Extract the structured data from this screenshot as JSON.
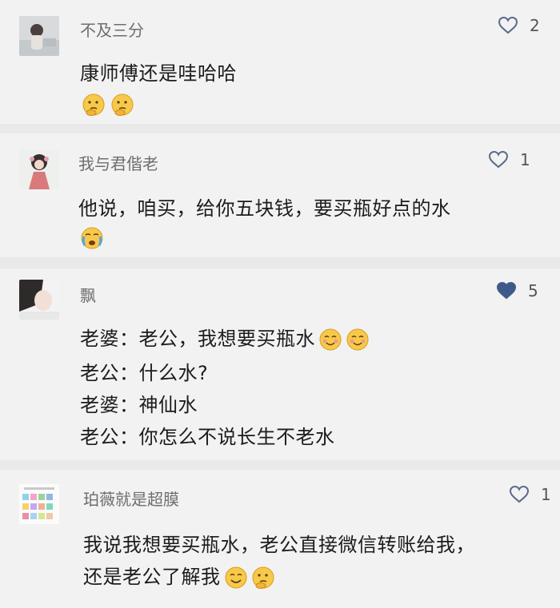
{
  "comments": [
    {
      "username": "不及三分",
      "likes": "2",
      "liked": false,
      "lines": [
        "康师傅还是哇哈哈"
      ],
      "emojis": [
        "thinking-emoji",
        "thinking-emoji"
      ]
    },
    {
      "username": "我与君偕老",
      "likes": "1",
      "liked": false,
      "lines": [
        "他说，咱买，给你五块钱，要买瓶好点的水"
      ],
      "emojis": [
        "crying-emoji"
      ]
    },
    {
      "username": "飘",
      "likes": "5",
      "liked": true,
      "lines": [
        "老婆：老公，我想要买瓶水",
        "老公：什么水?",
        "老婆：神仙水",
        "老公：你怎么不说长生不老水"
      ],
      "emojis": [
        "blush-emoji",
        "blush-emoji"
      ]
    },
    {
      "username": "珀薇就是超膜",
      "likes": "1",
      "liked": false,
      "lines": [
        "我说我想要买瓶水，老公直接微信转账给我，",
        "还是老公了解我"
      ],
      "emojis": [
        "smile-emoji",
        "thinking-emoji"
      ]
    }
  ],
  "colors": {
    "card_bg": "#f2f2f2",
    "separator": "#e9e9e9",
    "heart_outline": "#5b6b8c",
    "heart_filled": "#3f5a8a"
  }
}
